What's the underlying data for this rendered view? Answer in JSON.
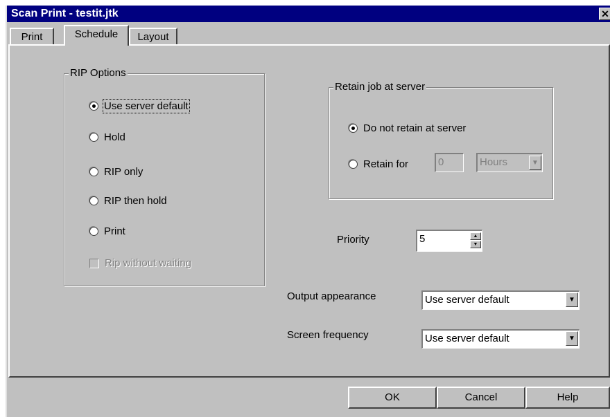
{
  "window": {
    "title": "Scan Print - testit.jtk",
    "close_glyph": "✕"
  },
  "tabs": [
    {
      "label": "Print",
      "active": false
    },
    {
      "label": "Schedule",
      "active": true
    },
    {
      "label": "Layout",
      "active": false
    }
  ],
  "rip_options": {
    "title": "RIP Options",
    "options": [
      {
        "label": "Use server default",
        "selected": true
      },
      {
        "label": "Hold",
        "selected": false
      },
      {
        "label": "RIP only",
        "selected": false
      },
      {
        "label": "RIP then hold",
        "selected": false
      },
      {
        "label": "Print",
        "selected": false
      }
    ],
    "rip_without_waiting": {
      "label": "Rip without waiting",
      "checked": false,
      "enabled": false
    }
  },
  "retain": {
    "title": "Retain job at server",
    "do_not_retain_label": "Do not retain at server",
    "do_not_retain_selected": true,
    "retain_for_label": "Retain for",
    "retain_for_value": "0",
    "retain_unit": "Hours"
  },
  "priority": {
    "label": "Priority",
    "value": "5"
  },
  "output_appearance": {
    "label": "Output appearance",
    "value": "Use server default"
  },
  "screen_frequency": {
    "label": "Screen frequency",
    "value": "Use server default"
  },
  "buttons": {
    "ok": "OK",
    "cancel": "Cancel",
    "help": "Help"
  }
}
